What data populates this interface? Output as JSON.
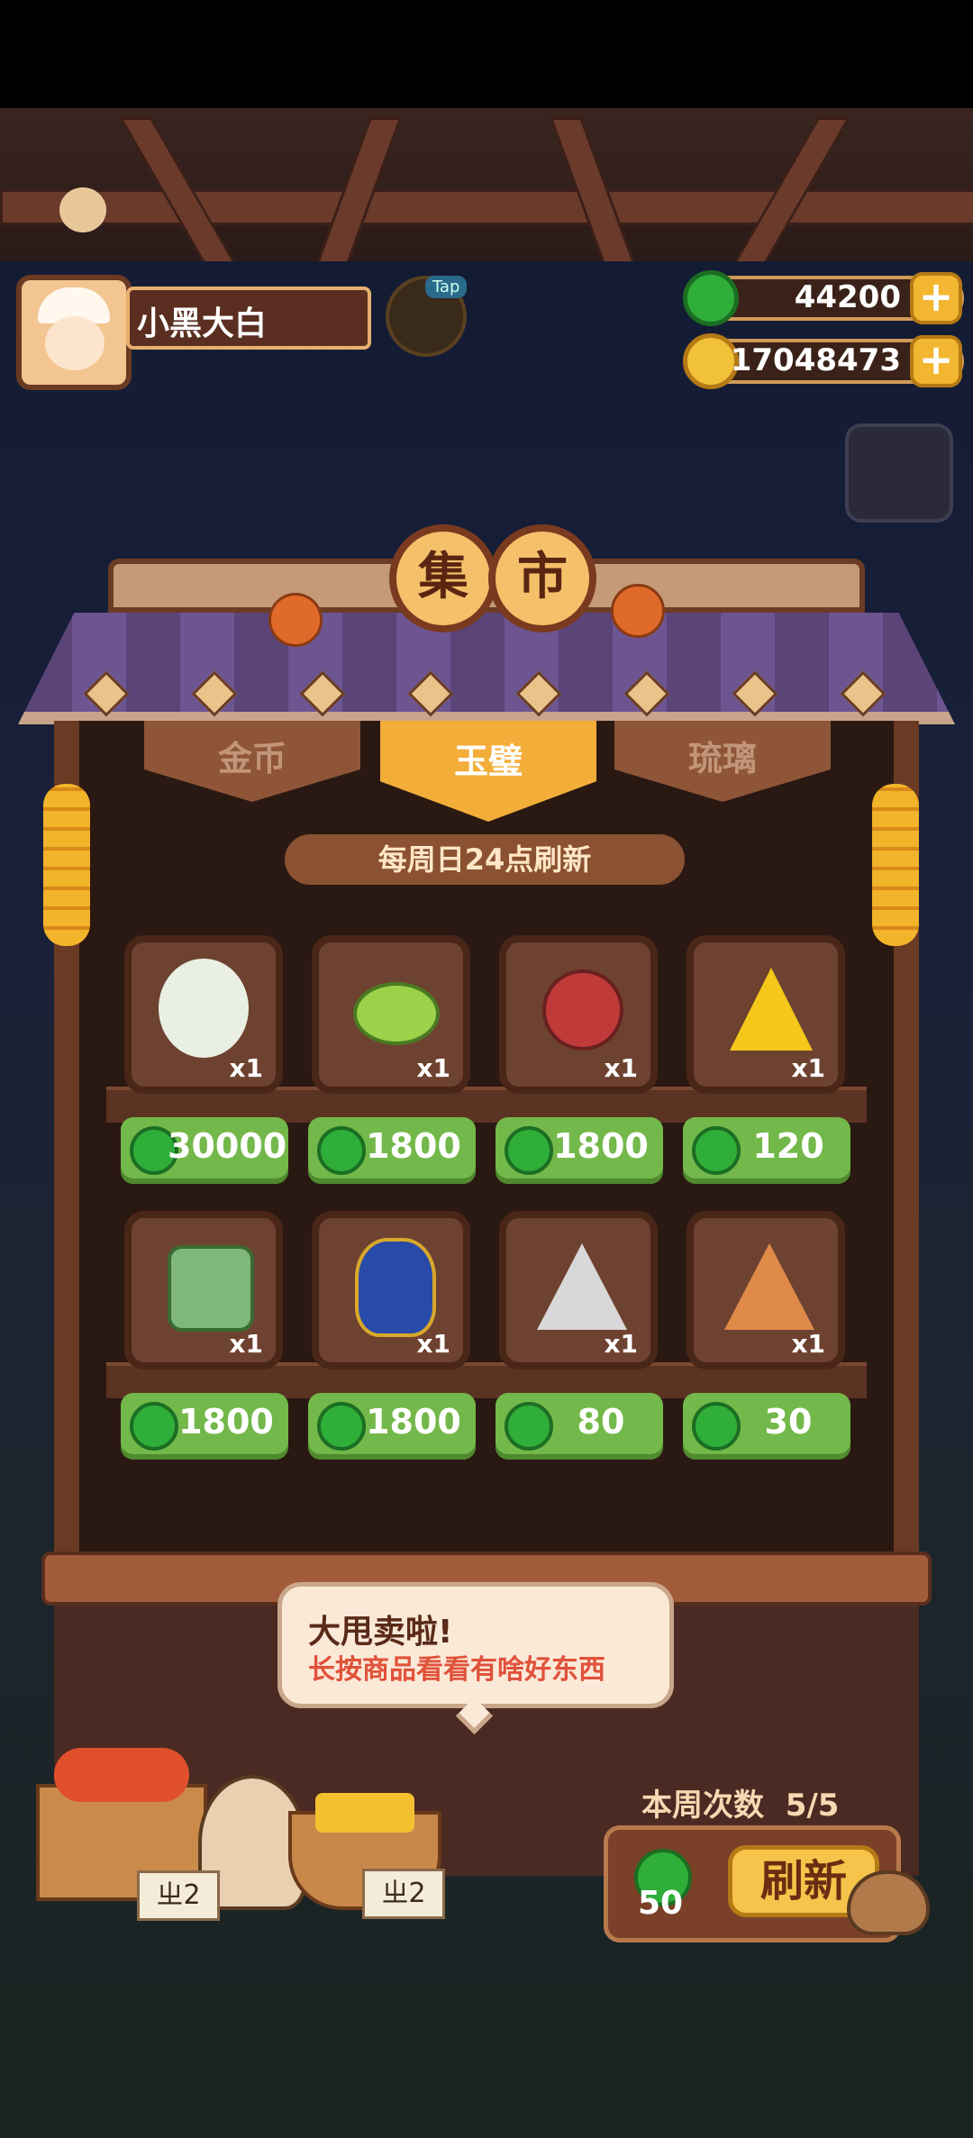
{
  "player": {
    "name": "小黑大白",
    "tap_label": "Tap"
  },
  "currencies": [
    {
      "name": "jade",
      "icon": "jade-coin-icon",
      "value": "44200",
      "color": "#2fae3a"
    },
    {
      "name": "gold",
      "icon": "gold-coin-icon",
      "value": "17048473",
      "color": "#f2b630"
    }
  ],
  "market": {
    "title_chars": [
      "集",
      "市"
    ],
    "tabs": [
      {
        "label": "金币",
        "active": false
      },
      {
        "label": "玉璧",
        "active": true
      },
      {
        "label": "琉璃",
        "active": false
      }
    ],
    "refresh_note": "每周日24点刷新",
    "items": [
      {
        "icon": "girl-character-icon",
        "qty": "x1",
        "price": "30000"
      },
      {
        "icon": "green-gem-icon",
        "qty": "x1",
        "price": "1800"
      },
      {
        "icon": "flower-bird-icon",
        "qty": "x1",
        "price": "1800"
      },
      {
        "icon": "yellow-talisman-icon",
        "qty": "x1",
        "price": "120"
      },
      {
        "icon": "jade-tablet-icon",
        "qty": "x1",
        "price": "1800"
      },
      {
        "icon": "cloisonne-vase-icon",
        "qty": "x1",
        "price": "1800"
      },
      {
        "icon": "white-talisman-icon",
        "qty": "x1",
        "price": "80"
      },
      {
        "icon": "orange-talisman-icon",
        "qty": "x1",
        "price": "30"
      }
    ]
  },
  "speech": {
    "title": "大甩卖啦!",
    "subtitle": "长按商品看看有啥好东西"
  },
  "refresh": {
    "weekly_label": "本周次数",
    "weekly_count": "5/5",
    "cost": "50",
    "button_label": "刷新"
  },
  "stall_signs": [
    "ㄓ2",
    "ㄓ2"
  ]
}
